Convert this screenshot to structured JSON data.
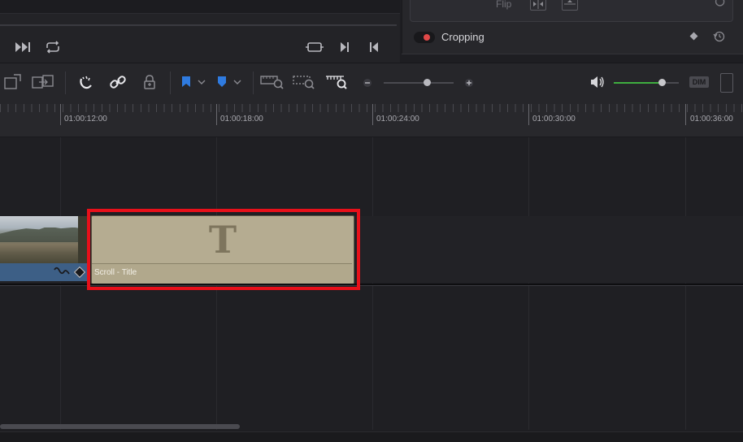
{
  "inspector": {
    "flip_label": "Flip",
    "cropping_label": "Cropping"
  },
  "colors": {
    "accent_red": "#e8101a",
    "title_clip": "#b5ac91",
    "video_clip": "#3d5f86",
    "volume": "#3fae3f",
    "flag_blue": "#2f7be0"
  },
  "toolbar": {
    "dim_label": "DIM",
    "zoom_level": 0.57,
    "volume_level": 0.75
  },
  "ruler": {
    "timecodes": [
      "01:00:12:00",
      "01:00:18:00",
      "01:00:24:00",
      "01:00:30:00",
      "01:00:36:00"
    ]
  },
  "timeline": {
    "title_clip_label": "Scroll - Title",
    "title_glyph": "T"
  },
  "icons": {
    "transport": [
      "fast-forward-icon",
      "loop-icon",
      "crop-frame-icon",
      "next-frame-icon",
      "previous-frame-icon"
    ],
    "tools": [
      "trim-icon",
      "dynamic-trim-icon",
      "snapping-icon",
      "link-icon",
      "lock-icon",
      "blue-flag-icon",
      "blue-marker-icon",
      "zoom-full-icon",
      "zoom-detail-icon",
      "zoom-custom-icon",
      "zoom-out-icon",
      "zoom-in-icon",
      "volume-icon"
    ]
  }
}
